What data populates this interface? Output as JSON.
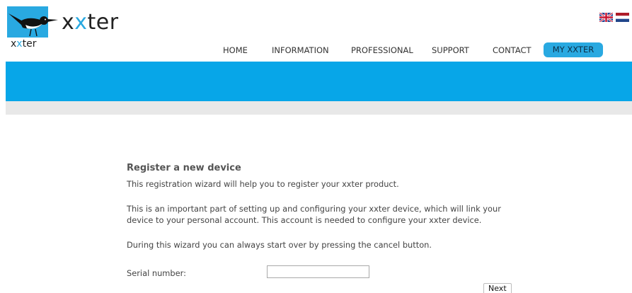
{
  "logo": {
    "brand_prefix": "x",
    "brand_x2": "x",
    "brand_suffix": "ter",
    "sub_prefix": "x",
    "sub_x2": "x",
    "sub_suffix": "ter"
  },
  "languages": [
    "en-flag-icon",
    "nl-flag-icon"
  ],
  "nav": {
    "items": [
      {
        "label": "HOME"
      },
      {
        "label": "INFORMATION"
      },
      {
        "label": "PROFESSIONAL"
      },
      {
        "label": "SUPPORT"
      },
      {
        "label": "CONTACT"
      },
      {
        "label": "MY XXTER"
      }
    ],
    "active_index": 5
  },
  "colors": {
    "accent": "#29a9e1",
    "banner": "#07a6e8",
    "subbar": "#e8e8e8"
  },
  "wizard": {
    "title": "Register a new device",
    "intro": "This registration wizard will help you to register your xxter product.",
    "important_line1": "This is an important part of setting up and configuring your xxter device, which will link your",
    "important_line2": "device to your personal account. This account is needed to configure your xxter device.",
    "cancel_note": "During this wizard you can always start over by pressing the cancel button.",
    "serial_label": "Serial number:",
    "serial_value": "",
    "next_label": "Next"
  }
}
